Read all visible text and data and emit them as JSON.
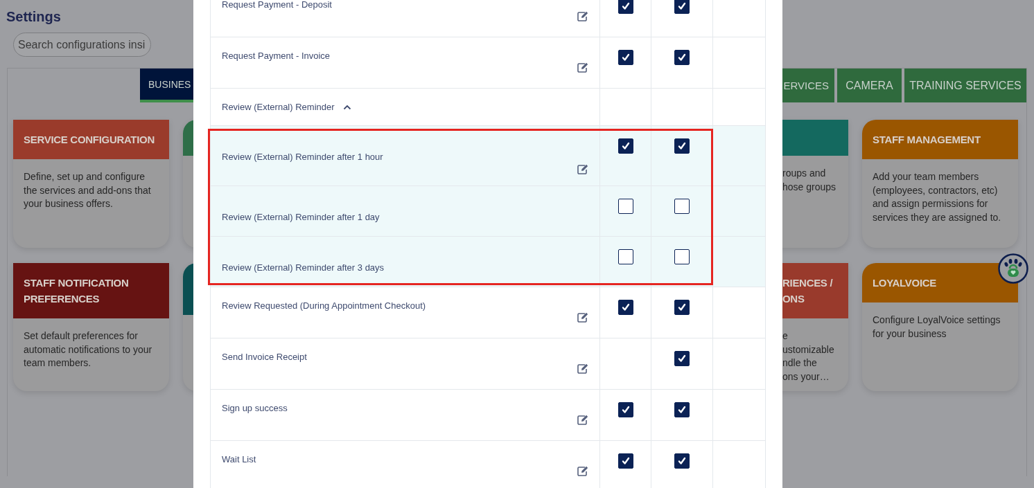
{
  "page": {
    "title": "Settings",
    "search": {
      "placeholder": "Search configurations insi"
    }
  },
  "tabs": [
    {
      "label": "BUSINES",
      "selected": true
    },
    {
      "label": "ERVICES",
      "selected": false
    },
    {
      "label": "CAMERA",
      "selected": false
    },
    {
      "label": "TRAINING SERVICES",
      "selected": false
    }
  ],
  "card_rows": [
    [
      {
        "kind": "full",
        "title": "SERVICE CONFIGURATION",
        "description": "Define, set up and configure the services and add-ons that your business offers.",
        "color": "#9a3b2b"
      },
      {
        "kind": "covered",
        "color": "#2e6e48"
      },
      {
        "kind": "partial",
        "lines": [
          "roups and",
          "hose groups"
        ],
        "color": "#14695f"
      },
      {
        "kind": "full",
        "title": "STAFF MANAGEMENT",
        "description": "Add your team members (employees, contractors, etc) and assign permissions for services they are assigned to.",
        "color": "#9a5600"
      }
    ],
    [
      {
        "kind": "full",
        "title": "STAFF NOTIFICATION PREFERENCES",
        "description": "Set default preferences for automatic notifications to your team members.",
        "color": "#661312"
      },
      {
        "kind": "covered",
        "color": "#0b4f52"
      },
      {
        "kind": "partial",
        "title_lines": [
          "RIENCES /",
          "ONS"
        ],
        "lines": [
          "e",
          "ustomizable",
          "ndle the",
          "ons your…"
        ],
        "color": "#993a2c"
      },
      {
        "kind": "full",
        "title": "LOYALVOICE",
        "description": "Configure LoyalVoice settings for your business",
        "color": "#9a5600"
      }
    ]
  ],
  "notifications": [
    {
      "kind": "item",
      "label": "Request Payment - Deposit",
      "editable": true,
      "column_2": true,
      "column_3": true
    },
    {
      "kind": "item",
      "label": "Request Payment - Invoice",
      "editable": true,
      "column_2": true,
      "column_3": true
    },
    {
      "kind": "group",
      "label": "Review (External) Reminder",
      "expanded": true,
      "outlined": true,
      "children": [
        {
          "label": "Review (External) Reminder after 1 hour",
          "editable": true,
          "column_2": true,
          "column_3": true
        },
        {
          "label": "Review (External) Reminder after 1 day",
          "editable": false,
          "column_2": false,
          "column_3": false
        },
        {
          "label": "Review (External) Reminder after 3 days",
          "editable": false,
          "column_2": false,
          "column_3": false
        }
      ]
    },
    {
      "kind": "item",
      "label": "Review Requested (During Appointment Checkout)",
      "editable": true,
      "column_2": true,
      "column_3": true
    },
    {
      "kind": "item",
      "label": "Send Invoice Receipt",
      "editable": true,
      "column_3": true
    },
    {
      "kind": "item",
      "label": "Sign up success",
      "editable": true,
      "column_2": true,
      "column_3": true
    },
    {
      "kind": "item",
      "label": "Wait List",
      "editable": true,
      "column_2": true,
      "column_3": true
    }
  ]
}
